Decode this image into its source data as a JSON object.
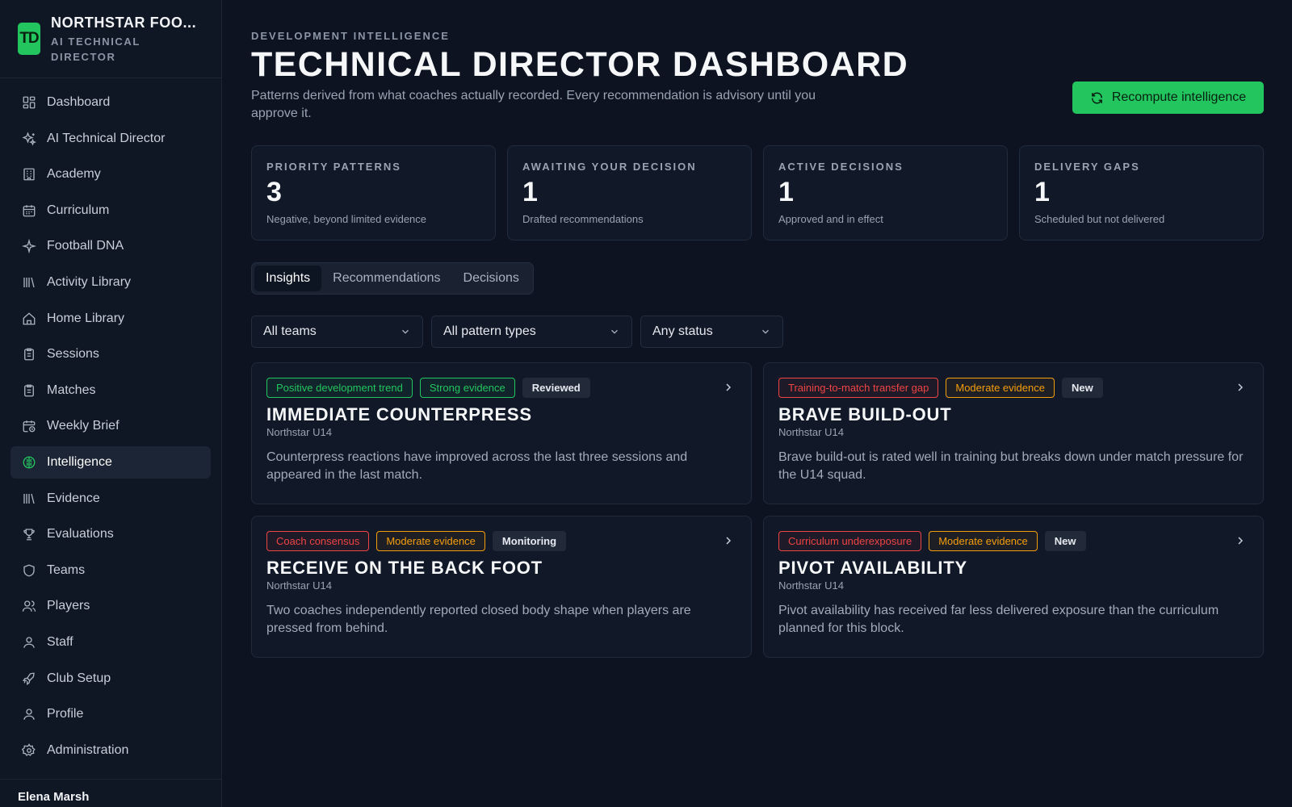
{
  "brand": {
    "logo_text": "TD",
    "name": "NORTHSTAR FOO...",
    "subtitle": "AI TECHNICAL DIRECTOR",
    "accent_color": "#22c55e"
  },
  "sidebar": {
    "items": [
      {
        "label": "Dashboard",
        "icon": "grid-icon"
      },
      {
        "label": "AI Technical Director",
        "icon": "sparkles-icon"
      },
      {
        "label": "Academy",
        "icon": "building-icon"
      },
      {
        "label": "Curriculum",
        "icon": "calendar-icon"
      },
      {
        "label": "Football DNA",
        "icon": "sparkle-icon"
      },
      {
        "label": "Activity Library",
        "icon": "library-icon"
      },
      {
        "label": "Home Library",
        "icon": "home-icon"
      },
      {
        "label": "Sessions",
        "icon": "clipboard-icon"
      },
      {
        "label": "Matches",
        "icon": "clipboard-icon"
      },
      {
        "label": "Weekly Brief",
        "icon": "calendar-clock-icon"
      },
      {
        "label": "Intelligence",
        "icon": "brain-icon",
        "active": true
      },
      {
        "label": "Evidence",
        "icon": "library-icon"
      },
      {
        "label": "Evaluations",
        "icon": "trophy-icon"
      },
      {
        "label": "Teams",
        "icon": "shield-icon"
      },
      {
        "label": "Players",
        "icon": "users-icon"
      },
      {
        "label": "Staff",
        "icon": "user-icon"
      },
      {
        "label": "Club Setup",
        "icon": "rocket-icon"
      },
      {
        "label": "Profile",
        "icon": "user-icon"
      },
      {
        "label": "Administration",
        "icon": "gear-icon"
      }
    ],
    "footer_user": "Elena Marsh"
  },
  "header": {
    "eyebrow": "DEVELOPMENT INTELLIGENCE",
    "title": "TECHNICAL DIRECTOR DASHBOARD",
    "subtitle": "Patterns derived from what coaches actually recorded. Every recommendation is advisory until you approve it.",
    "action_label": "Recompute intelligence"
  },
  "stats": [
    {
      "label": "PRIORITY PATTERNS",
      "value": "3",
      "desc": "Negative, beyond limited evidence"
    },
    {
      "label": "AWAITING YOUR DECISION",
      "value": "1",
      "desc": "Drafted recommendations"
    },
    {
      "label": "ACTIVE DECISIONS",
      "value": "1",
      "desc": "Approved and in effect"
    },
    {
      "label": "DELIVERY GAPS",
      "value": "1",
      "desc": "Scheduled but not delivered"
    }
  ],
  "tabs": [
    {
      "label": "Insights",
      "active": true
    },
    {
      "label": "Recommendations"
    },
    {
      "label": "Decisions"
    }
  ],
  "filters": [
    {
      "value": "All teams"
    },
    {
      "value": "All pattern types"
    },
    {
      "value": "Any status"
    }
  ],
  "insights": [
    {
      "badges": [
        {
          "text": "Positive development trend",
          "tone": "green"
        },
        {
          "text": "Strong evidence",
          "tone": "green"
        },
        {
          "text": "Reviewed",
          "tone": "grey"
        }
      ],
      "title": "IMMEDIATE COUNTERPRESS",
      "team": "Northstar U14",
      "desc": "Counterpress reactions have improved across the last three sessions and appeared in the last match."
    },
    {
      "badges": [
        {
          "text": "Training-to-match transfer gap",
          "tone": "red"
        },
        {
          "text": "Moderate evidence",
          "tone": "orange"
        },
        {
          "text": "New",
          "tone": "grey"
        }
      ],
      "title": "BRAVE BUILD-OUT",
      "team": "Northstar U14",
      "desc": "Brave build-out is rated well in training but breaks down under match pressure for the U14 squad."
    },
    {
      "badges": [
        {
          "text": "Coach consensus",
          "tone": "red"
        },
        {
          "text": "Moderate evidence",
          "tone": "orange"
        },
        {
          "text": "Monitoring",
          "tone": "grey"
        }
      ],
      "title": "RECEIVE ON THE BACK FOOT",
      "team": "Northstar U14",
      "desc": "Two coaches independently reported closed body shape when players are pressed from behind."
    },
    {
      "badges": [
        {
          "text": "Curriculum underexposure",
          "tone": "red"
        },
        {
          "text": "Moderate evidence",
          "tone": "orange"
        },
        {
          "text": "New",
          "tone": "grey"
        }
      ],
      "title": "PIVOT AVAILABILITY",
      "team": "Northstar U14",
      "desc": "Pivot availability has received far less delivered exposure than the curriculum planned for this block."
    }
  ]
}
